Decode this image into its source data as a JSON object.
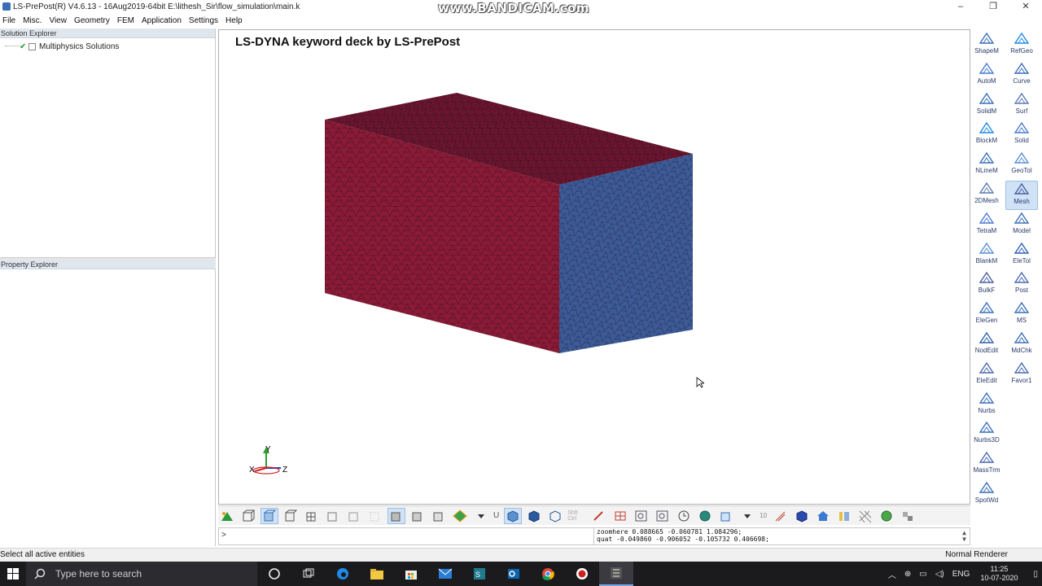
{
  "window": {
    "title": "LS-PrePost(R) V4.6.13 - 16Aug2019-64bit E:\\lithesh_Sir\\flow_simulation\\main.k",
    "watermark": "www.BANDICAM.com",
    "minimize_glyph": "–",
    "maximize_glyph": "❐",
    "close_glyph": "✕"
  },
  "menubar": {
    "items": [
      "File",
      "Misc.",
      "View",
      "Geometry",
      "FEM",
      "Application",
      "Settings",
      "Help"
    ]
  },
  "solution_explorer": {
    "header": "Solution Explorer",
    "items": [
      {
        "label": "Multiphysics Solutions",
        "checked": true
      }
    ]
  },
  "property_explorer": {
    "header": "Property Explorer"
  },
  "viewport": {
    "title": "LS-DYNA keyword deck by LS-PrePost",
    "model": {
      "top_color": "#6b1530",
      "front_color": "#8a1a36",
      "side_color": "#3e5a96",
      "mesh_line_color": "#1a1a1a"
    },
    "triad": {
      "x_label": "X",
      "y_label": "Y",
      "z_label": "Z"
    }
  },
  "right_toolbar": {
    "left_column": [
      "ShapeM",
      "AutoM",
      "SolidM",
      "BlockM",
      "NLineM",
      "2DMesh",
      "TetraM",
      "BlankM",
      "BulkF",
      "EleGen",
      "NodEdit",
      "EleEdit",
      "Nurbs",
      "Nurbs3D",
      "MassTrm",
      "SpotWd"
    ],
    "right_column": [
      "RefGeo",
      "Curve",
      "Surf",
      "Solid",
      "GeoTol",
      "Mesh",
      "Model",
      "EleTol",
      "Post",
      "MS",
      "MdChk",
      "Favor1"
    ],
    "active": "Mesh"
  },
  "bottom_toolbar": {
    "text_u": "U",
    "text_shift": "Shft Ctrl",
    "text_10": "10"
  },
  "command": {
    "prompt": ">",
    "messages": [
      "zoomhere 0.088665 -0.060781 1.084296;",
      "quat -0.049860 -0.906052 -0.105732 0.406698;"
    ]
  },
  "statusbar": {
    "left": "Select all active entities",
    "right": "Normal Renderer"
  },
  "taskbar": {
    "search_placeholder": "Type here to search",
    "language": "ENG",
    "time": "11:25",
    "date": "10-07-2020"
  }
}
